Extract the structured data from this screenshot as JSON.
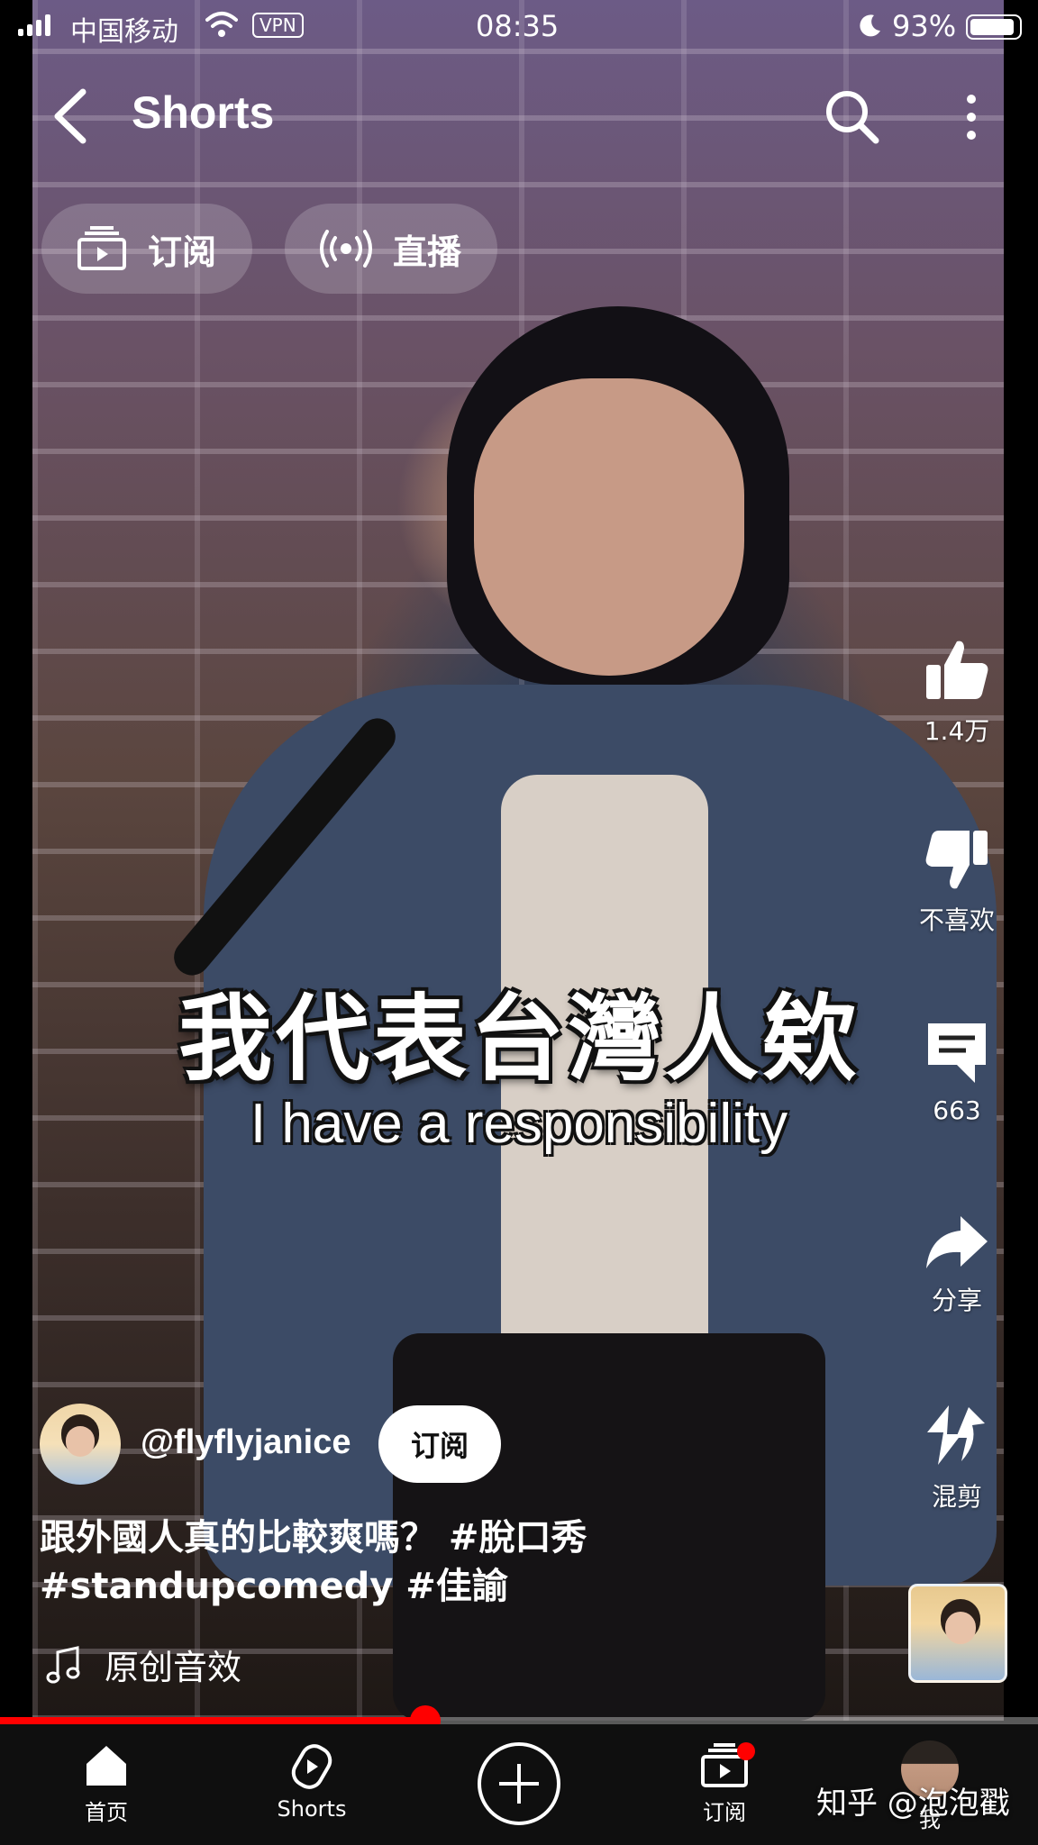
{
  "status_bar": {
    "carrier": "中国移动",
    "vpn": "VPN",
    "time": "08:35",
    "battery_pct": "93%",
    "battery_level": 0.93
  },
  "header": {
    "title": "Shorts"
  },
  "chips": [
    {
      "label": "订阅",
      "icon": "subscriptions-icon"
    },
    {
      "label": "直播",
      "icon": "live-icon"
    }
  ],
  "captions": {
    "zh": "我代表台灣人欸",
    "en": "I have a responsibility"
  },
  "actions": {
    "like_count": "1.4万",
    "dislike_label": "不喜欢",
    "comment_count": "663",
    "share_label": "分享",
    "remix_label": "混剪"
  },
  "channel": {
    "handle": "@flyflyjanice",
    "subscribe_label": "订阅"
  },
  "description": {
    "line1": "跟外國人真的比較爽嗎？ #脫口秀",
    "line2": "#standupcomedy #佳諭"
  },
  "music": {
    "label": "原创音效"
  },
  "progress": {
    "played_fraction": 0.41
  },
  "nav": {
    "home": "首页",
    "shorts": "Shorts",
    "subscriptions": "订阅",
    "me": "我"
  },
  "watermark": "知乎 @泡泡戳",
  "colors": {
    "accent": "#ff0000",
    "nav_bg": "#0f0f0f"
  }
}
